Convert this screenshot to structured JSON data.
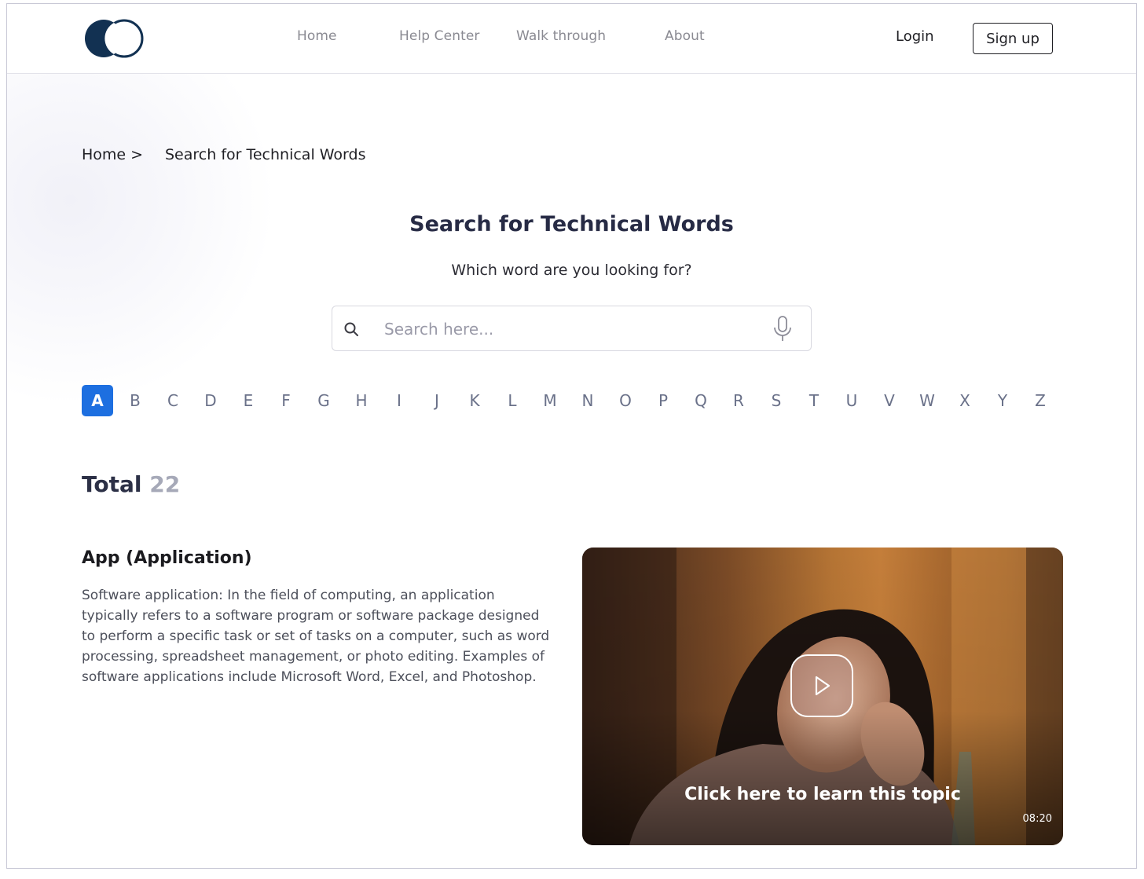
{
  "header": {
    "nav": [
      "Home",
      "Help Center",
      "Walk through",
      "About"
    ],
    "login_label": "Login",
    "signup_label": "Sign up"
  },
  "breadcrumb": {
    "home": "Home >",
    "current": "Search for Technical Words"
  },
  "hero": {
    "title": "Search for Technical Words",
    "subtitle": "Which word are you looking for?"
  },
  "search": {
    "placeholder": "Search here...",
    "value": ""
  },
  "alphabet": {
    "letters": [
      "A",
      "B",
      "C",
      "D",
      "E",
      "F",
      "G",
      "H",
      "I",
      "J",
      "K",
      "L",
      "M",
      "N",
      "O",
      "P",
      "Q",
      "R",
      "S",
      "T",
      "U",
      "V",
      "W",
      "X",
      "Y",
      "Z"
    ],
    "active": "A"
  },
  "total": {
    "label": "Total",
    "count": "22"
  },
  "entry": {
    "title": "App (Application)",
    "description": "Software application: In the field of computing, an application typically refers to a software program or software package designed to perform a specific task or set of tasks on a computer, such as word processing, spreadsheet management, or photo editing. Examples of software applications include Microsoft Word, Excel, and Photoshop."
  },
  "video": {
    "caption": "Click here to learn this topic",
    "duration": "08:20"
  },
  "colors": {
    "brand": "#123152",
    "accent": "#1d6fe0",
    "title": "#272b45"
  }
}
